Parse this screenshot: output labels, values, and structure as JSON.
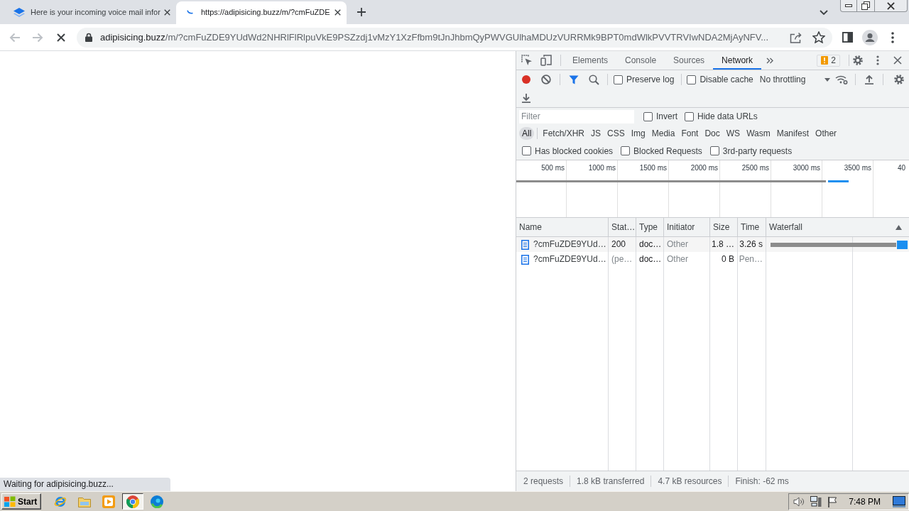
{
  "browser_tabs": [
    {
      "title": "Here is your incoming voice mail infor",
      "selected": false,
      "loading": false
    },
    {
      "title": "https://adipisicing.buzz/m/?cmFuZDE",
      "selected": true,
      "loading": true
    }
  ],
  "address_bar": {
    "host": "adipisicing.buzz",
    "path": "/m/?cmFuZDE9YUdWd2NHRlFlRlpuVkE9PSZzdj1vMzY1XzFfbm9tJnJhbmQyPWVGUlhaMDUzVURRMk9BPT0mdWlkPVVTRVIwNDA2MjAyNFV..."
  },
  "status_bubble": "Waiting for adipisicing.buzz...",
  "devtools": {
    "panel_tabs": [
      {
        "label": "Elements",
        "selected": false
      },
      {
        "label": "Console",
        "selected": false
      },
      {
        "label": "Sources",
        "selected": false
      },
      {
        "label": "Network",
        "selected": true
      }
    ],
    "issues_count": "2",
    "recording": true,
    "toolbar_checkboxes": [
      {
        "label": "Preserve log",
        "checked": false
      },
      {
        "label": "Disable cache",
        "checked": false
      }
    ],
    "throttling": "No throttling",
    "filter": {
      "placeholder": "Filter"
    },
    "filter_options": [
      {
        "label": "Invert",
        "checked": false
      },
      {
        "label": "Hide data URLs",
        "checked": false
      }
    ],
    "type_filters": [
      {
        "label": "All",
        "selected": true
      },
      {
        "label": "Fetch/XHR",
        "selected": false
      },
      {
        "label": "JS",
        "selected": false
      },
      {
        "label": "CSS",
        "selected": false
      },
      {
        "label": "Img",
        "selected": false
      },
      {
        "label": "Media",
        "selected": false
      },
      {
        "label": "Font",
        "selected": false
      },
      {
        "label": "Doc",
        "selected": false
      },
      {
        "label": "WS",
        "selected": false
      },
      {
        "label": "Wasm",
        "selected": false
      },
      {
        "label": "Manifest",
        "selected": false
      },
      {
        "label": "Other",
        "selected": false
      }
    ],
    "request_filters": [
      {
        "label": "Has blocked cookies",
        "checked": false
      },
      {
        "label": "Blocked Requests",
        "checked": false
      },
      {
        "label": "3rd-party requests",
        "checked": false
      }
    ],
    "overview_ticks": [
      "500 ms",
      "1000 ms",
      "1500 ms",
      "2000 ms",
      "2500 ms",
      "3000 ms",
      "3500 ms",
      "40"
    ],
    "table": {
      "columns": [
        {
          "label": "Name",
          "sorted": false
        },
        {
          "label": "Stat…",
          "sorted": false
        },
        {
          "label": "Type",
          "sorted": false
        },
        {
          "label": "Initiator",
          "sorted": false
        },
        {
          "label": "Size",
          "sorted": false
        },
        {
          "label": "Time",
          "sorted": false
        },
        {
          "label": "Waterfall",
          "sorted": true
        }
      ],
      "rows": [
        {
          "cells": [
            {
              "text": "?cmFuZDE9YUd…",
              "dimmed": false
            },
            {
              "text": "200",
              "dimmed": false
            },
            {
              "text": "doc…",
              "dimmed": false
            },
            {
              "text": "Other",
              "dimmed": true
            },
            {
              "text": "1.8 …",
              "dimmed": false
            },
            {
              "text": "3.26 s",
              "dimmed": false
            }
          ],
          "waterfall_bar": true
        },
        {
          "cells": [
            {
              "text": "?cmFuZDE9YUd…",
              "dimmed": false
            },
            {
              "text": "(pe…",
              "dimmed": true
            },
            {
              "text": "doc…",
              "dimmed": false
            },
            {
              "text": "Other",
              "dimmed": true
            },
            {
              "text": "0 B",
              "dimmed": false
            },
            {
              "text": "Pen…",
              "dimmed": true
            }
          ],
          "waterfall_bar": false
        }
      ]
    },
    "summary": [
      "2 requests",
      "1.8 kB transferred",
      "4.7 kB resources",
      "Finish: -62 ms"
    ]
  },
  "taskbar": {
    "start": "Start",
    "apps": [
      {
        "kind": "e_logo",
        "selected": false
      },
      {
        "kind": "folder",
        "selected": false
      },
      {
        "kind": "player",
        "selected": false
      },
      {
        "kind": "ring_logo",
        "selected": true
      },
      {
        "kind": "swirl_logo",
        "selected": false
      }
    ],
    "clock": "7:48 PM"
  }
}
